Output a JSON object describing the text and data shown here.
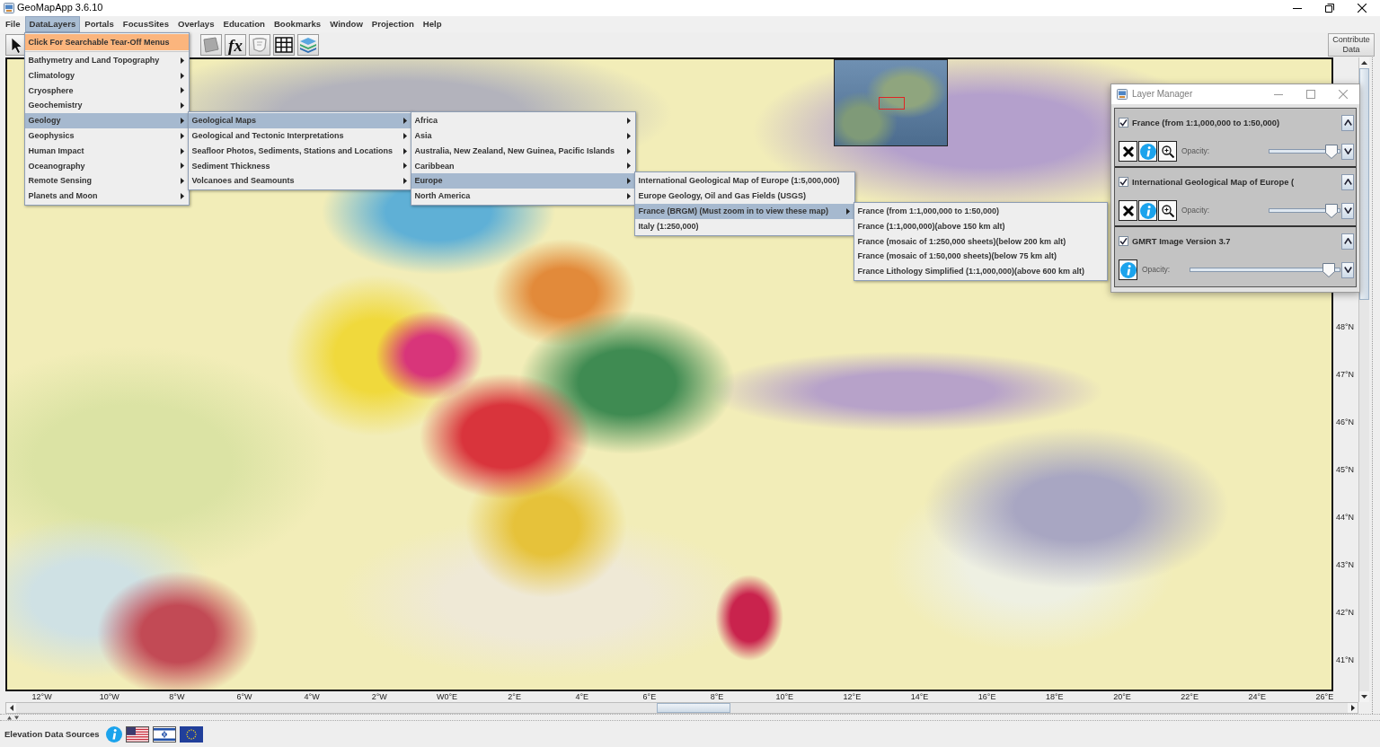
{
  "window": {
    "title": "GeoMapApp 3.6.10"
  },
  "menu_bar": [
    {
      "label": "File",
      "selected": false
    },
    {
      "label": "DataLayers",
      "selected": true
    },
    {
      "label": "Portals",
      "selected": false
    },
    {
      "label": "FocusSites",
      "selected": false
    },
    {
      "label": "Overlays",
      "selected": false
    },
    {
      "label": "Education",
      "selected": false
    },
    {
      "label": "Bookmarks",
      "selected": false
    },
    {
      "label": "Window",
      "selected": false
    },
    {
      "label": "Projection",
      "selected": false
    },
    {
      "label": "Help",
      "selected": false
    }
  ],
  "toolbar": {
    "tools": [
      {
        "kind": "pointer"
      },
      {
        "kind": "shape"
      },
      {
        "kind": "function",
        "label": "fx"
      },
      {
        "kind": "outline"
      },
      {
        "kind": "grid"
      },
      {
        "kind": "layers"
      }
    ],
    "contribute_button": "Contribute Data"
  },
  "menus": [
    {
      "items": [
        {
          "kind": "tear_off",
          "label": "Click For Searchable Tear-Off Menus",
          "selected": false
        },
        {
          "kind": "submenu",
          "label": "Bathymetry and Land Topography",
          "selected": false
        },
        {
          "kind": "submenu",
          "label": "Climatology",
          "selected": false
        },
        {
          "kind": "submenu",
          "label": "Cryosphere",
          "selected": false
        },
        {
          "kind": "submenu",
          "label": "Geochemistry",
          "selected": false
        },
        {
          "kind": "submenu",
          "label": "Geology",
          "selected": true
        },
        {
          "kind": "submenu",
          "label": "Geophysics",
          "selected": false
        },
        {
          "kind": "submenu",
          "label": "Human Impact",
          "selected": false
        },
        {
          "kind": "submenu",
          "label": "Oceanography",
          "selected": false
        },
        {
          "kind": "submenu",
          "label": "Remote Sensing",
          "selected": false
        },
        {
          "kind": "submenu",
          "label": "Planets and Moon",
          "selected": false
        }
      ]
    },
    {
      "items": [
        {
          "kind": "submenu",
          "label": "Geological Maps",
          "selected": true
        },
        {
          "kind": "submenu",
          "label": "Geological and Tectonic Interpretations",
          "selected": false
        },
        {
          "kind": "submenu",
          "label": "Seafloor Photos, Sediments, Stations and Locations",
          "selected": false
        },
        {
          "kind": "submenu",
          "label": "Sediment Thickness",
          "selected": false
        },
        {
          "kind": "submenu",
          "label": "Volcanoes and Seamounts",
          "selected": false
        }
      ]
    },
    {
      "items": [
        {
          "kind": "submenu",
          "label": "Africa",
          "selected": false
        },
        {
          "kind": "submenu",
          "label": "Asia",
          "selected": false
        },
        {
          "kind": "submenu",
          "label": "Australia, New Zealand, New Guinea, Pacific Islands",
          "selected": false
        },
        {
          "kind": "submenu",
          "label": "Caribbean",
          "selected": false
        },
        {
          "kind": "submenu",
          "label": "Europe",
          "selected": true
        },
        {
          "kind": "submenu",
          "label": "North America",
          "selected": false
        }
      ]
    },
    {
      "items": [
        {
          "kind": "item",
          "label": "International Geological Map of Europe (1:5,000,000)",
          "selected": false
        },
        {
          "kind": "item",
          "label": "Europe Geology, Oil and Gas Fields (USGS)",
          "selected": false
        },
        {
          "kind": "submenu",
          "label": "France (BRGM) (Must zoom in to view these map)",
          "selected": true
        },
        {
          "kind": "item",
          "label": "Italy (1:250,000)",
          "selected": false
        }
      ]
    },
    {
      "items": [
        {
          "kind": "item",
          "label": "France (from 1:1,000,000 to 1:50,000)",
          "selected": false
        },
        {
          "kind": "item",
          "label": "France (1:1,000,000)(above 150 km alt)",
          "selected": false
        },
        {
          "kind": "item",
          "label": "France (mosaic of 1:250,000 sheets)(below 200 km alt)",
          "selected": false
        },
        {
          "kind": "item",
          "label": "France (mosaic of 1:50,000 sheets)(below 75 km alt)",
          "selected": false
        },
        {
          "kind": "item",
          "label": "France Lithology Simplified (1:1,000,000)(above 600 km alt)",
          "selected": false
        }
      ]
    }
  ],
  "map": {
    "longitude_labels": [
      "12°W",
      "10°W",
      "8°W",
      "6°W",
      "4°W",
      "2°W",
      "W0°E",
      "2°E",
      "4°E",
      "6°E",
      "8°E",
      "10°E",
      "12°E",
      "14°E",
      "16°E",
      "18°E",
      "20°E",
      "22°E",
      "24°E",
      "26°E"
    ],
    "latitude_labels": [
      "48°N",
      "47°N",
      "46°N",
      "45°N",
      "44°N",
      "43°N",
      "42°N",
      "41°N"
    ]
  },
  "layer_manager": {
    "title": "Layer Manager",
    "layers": [
      {
        "name": "France (from 1:1,000,000 to 1:50,000)",
        "checked": true,
        "tools": [
          {
            "kind": "remove"
          },
          {
            "kind": "info"
          },
          {
            "kind": "zoom"
          }
        ],
        "opacity_label": "Opacity:",
        "level": 0.95
      },
      {
        "name": "International Geological Map of Europe (",
        "checked": true,
        "tools": [
          {
            "kind": "remove"
          },
          {
            "kind": "info"
          },
          {
            "kind": "zoom"
          }
        ],
        "opacity_label": "Opacity:",
        "level": 0.95
      },
      {
        "name": "GMRT Image Version 3.7",
        "checked": true,
        "tools": [
          {
            "kind": "info"
          }
        ],
        "opacity_label": "Opacity:",
        "level": 0.96
      }
    ]
  },
  "status_bar": {
    "label": "Elevation Data Sources",
    "sources": [
      {
        "kind": "info"
      },
      {
        "kind": "us_flag"
      },
      {
        "kind": "israel_flag"
      },
      {
        "kind": "eu_flag"
      }
    ]
  }
}
